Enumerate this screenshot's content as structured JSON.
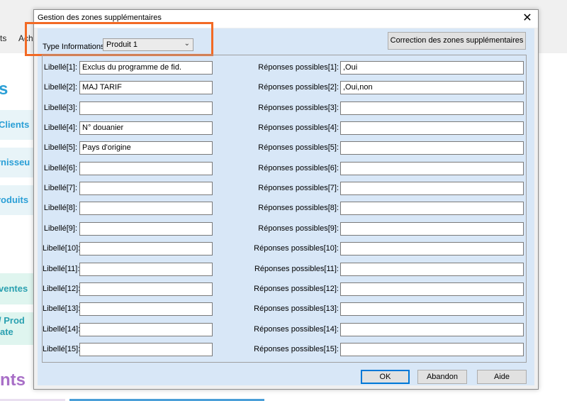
{
  "background": {
    "menu_items": [
      "ts",
      "Acha"
    ],
    "title_fragment": "s",
    "tiles": [
      "Clients",
      "rnisseu",
      "roduits",
      "ventes",
      "/ Prod",
      "ate"
    ],
    "purple_fragment": "nts"
  },
  "dialog": {
    "title": "Gestion des zones supplémentaires",
    "close_glyph": "✕",
    "type_label": "Type Informations:",
    "type_value": "Produit 1",
    "correction_button": "Correction des zones supplémentaires",
    "rows": [
      {
        "lib_label": "Libellé[1]:",
        "lib_value": "Exclus du programme de fid.",
        "rep_label": "Réponses possibles[1]:",
        "rep_value": ",Oui"
      },
      {
        "lib_label": "Libellé[2]:",
        "lib_value": "MAJ TARIF",
        "rep_label": "Réponses possibles[2]:",
        "rep_value": ",Oui,non"
      },
      {
        "lib_label": "Libellé[3]:",
        "lib_value": "",
        "rep_label": "Réponses possibles[3]:",
        "rep_value": ""
      },
      {
        "lib_label": "Libellé[4]:",
        "lib_value": "N° douanier",
        "rep_label": "Réponses possibles[4]:",
        "rep_value": ""
      },
      {
        "lib_label": "Libellé[5]:",
        "lib_value": "Pays d'origine",
        "rep_label": "Réponses possibles[5]:",
        "rep_value": ""
      },
      {
        "lib_label": "Libellé[6]:",
        "lib_value": "",
        "rep_label": "Réponses possibles[6]:",
        "rep_value": ""
      },
      {
        "lib_label": "Libellé[7]:",
        "lib_value": "",
        "rep_label": "Réponses possibles[7]:",
        "rep_value": ""
      },
      {
        "lib_label": "Libellé[8]:",
        "lib_value": "",
        "rep_label": "Réponses possibles[8]:",
        "rep_value": ""
      },
      {
        "lib_label": "Libellé[9]:",
        "lib_value": "",
        "rep_label": "Réponses possibles[9]:",
        "rep_value": ""
      },
      {
        "lib_label": "Libellé[10]:",
        "lib_value": "",
        "rep_label": "Réponses possibles[10]:",
        "rep_value": ""
      },
      {
        "lib_label": "Libellé[11]:",
        "lib_value": "",
        "rep_label": "Réponses possibles[11]:",
        "rep_value": ""
      },
      {
        "lib_label": "Libellé[12]:",
        "lib_value": "",
        "rep_label": "Réponses possibles[12]:",
        "rep_value": ""
      },
      {
        "lib_label": "Libellé[13]:",
        "lib_value": "",
        "rep_label": "Réponses possibles[13]:",
        "rep_value": ""
      },
      {
        "lib_label": "Libellé[14]:",
        "lib_value": "",
        "rep_label": "Réponses possibles[14]:",
        "rep_value": ""
      },
      {
        "lib_label": "Libellé[15]:",
        "lib_value": "",
        "rep_label": "Réponses possibles[15]:",
        "rep_value": ""
      }
    ],
    "ok_button": "OK",
    "abandon_button": "Abandon",
    "aide_button": "Aide"
  },
  "colors": {
    "dialog_body": "#d8e7f7",
    "highlight": "#f26a25",
    "accent_blue": "#2a9fd6"
  }
}
